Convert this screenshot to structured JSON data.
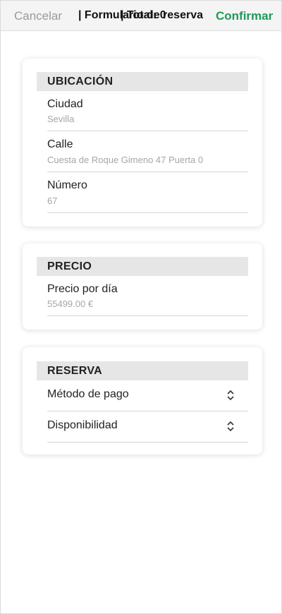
{
  "header": {
    "cancel_label": "Cancelar",
    "title_layer_1": "| Formulario de reserva",
    "title_layer_2": "| Total: 0",
    "confirm_label": "Confirmar",
    "confirm_color": "#1e9a5a"
  },
  "ubicacion": {
    "heading": "UBICACIÓN",
    "fields": [
      {
        "label": "Ciudad",
        "value": "Sevilla"
      },
      {
        "label": "Calle",
        "value": "Cuesta de Roque Gimeno 47 Puerta 0"
      },
      {
        "label": "Número",
        "value": "67"
      }
    ]
  },
  "precio": {
    "heading": "PRECIO",
    "fields": [
      {
        "label": "Precio por día",
        "value": "55499.00 €"
      }
    ]
  },
  "reserva": {
    "heading": "RESERVA",
    "pickers": [
      {
        "label": "Método de pago",
        "icon": "chevron-up-down-icon"
      },
      {
        "label": "Disponibilidad",
        "icon": "chevron-up-down-icon"
      }
    ]
  }
}
